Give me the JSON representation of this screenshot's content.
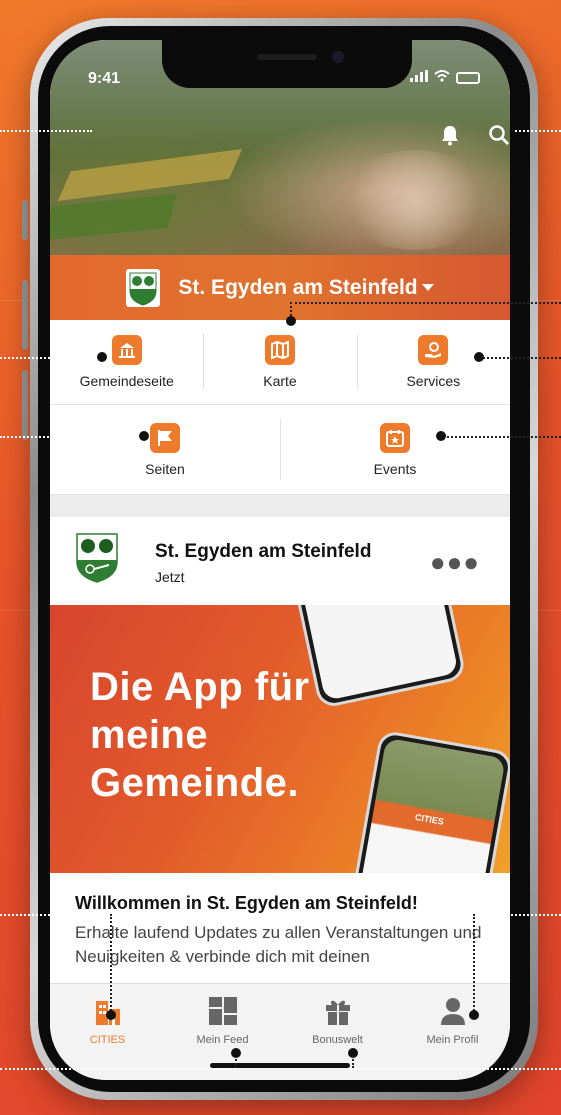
{
  "status": {
    "time": "9:41"
  },
  "hero": {
    "icons": [
      "bell-icon",
      "search-icon"
    ]
  },
  "community": {
    "name": "St. Egyden am Steinfeld",
    "dropdown_icon": "caret-down-icon"
  },
  "quick_nav": {
    "row1": [
      {
        "label": "Gemeindeseite",
        "icon": "town-hall-icon"
      },
      {
        "label": "Karte",
        "icon": "map-icon"
      },
      {
        "label": "Services",
        "icon": "services-icon"
      }
    ],
    "row2": [
      {
        "label": "Seiten",
        "icon": "flag-icon"
      },
      {
        "label": "Events",
        "icon": "calendar-star-icon"
      }
    ]
  },
  "post": {
    "author": "St. Egyden am Steinfeld",
    "time": "Jetzt",
    "more_icon": "more-icon",
    "banner_text": "Die App für meine Gemeinde.",
    "mini_phone_label": "CITIES",
    "heading": "Willkommen in St. Egyden am Steinfeld!",
    "text": "Erhalte laufend Updates zu allen Veranstaltungen und Neuigkeiten & verbinde dich mit deinen"
  },
  "tabs": [
    {
      "label": "CITIES",
      "icon": "cities-icon",
      "active": true
    },
    {
      "label": "Mein Feed",
      "icon": "feed-icon",
      "active": false
    },
    {
      "label": "Bonuswelt",
      "icon": "gift-icon",
      "active": false
    },
    {
      "label": "Mein Profil",
      "icon": "profile-icon",
      "active": false
    }
  ],
  "colors": {
    "accent": "#ee7a2b",
    "background": "#e8532a",
    "crest_green": "#2e7d32"
  }
}
